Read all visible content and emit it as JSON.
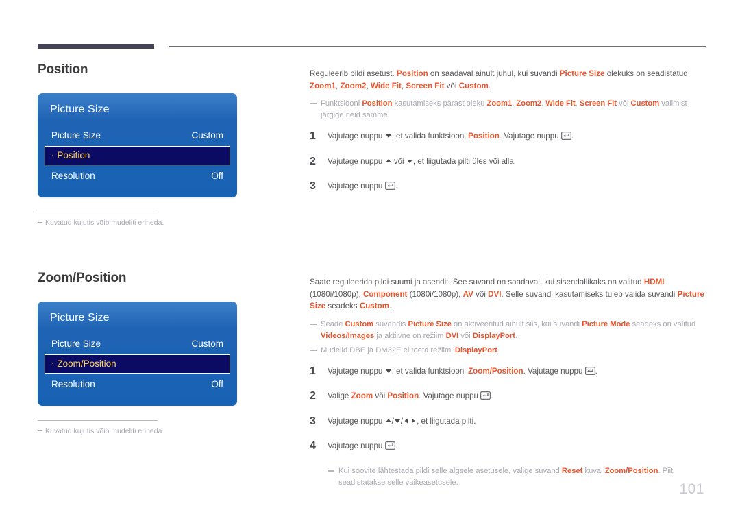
{
  "page": {
    "number": "101"
  },
  "sections": [
    {
      "id": "position",
      "heading": "Position",
      "osd": {
        "title": "Picture Size",
        "rows": [
          {
            "label": "Picture Size",
            "value": "Custom",
            "selected": false
          },
          {
            "label": "Position",
            "value": "",
            "selected": true
          },
          {
            "label": "Resolution",
            "value": "Off",
            "selected": false
          }
        ]
      },
      "osd_note": "Kuvatud kujutis võib mudeliti erineda."
    },
    {
      "id": "zoomposition",
      "heading": "Zoom/Position",
      "osd": {
        "title": "Picture Size",
        "rows": [
          {
            "label": "Picture Size",
            "value": "Custom",
            "selected": false
          },
          {
            "label": "Zoom/Position",
            "value": "",
            "selected": true
          },
          {
            "label": "Resolution",
            "value": "Off",
            "selected": false
          }
        ]
      },
      "osd_note": "Kuvatud kujutis võib mudeliti erineda."
    }
  ],
  "position_body": {
    "intro_1a": "Reguleerib pildi asetust. ",
    "intro_kw1": "Position",
    "intro_1b": " on saadaval ainult juhul, kui suvandi ",
    "intro_kw2": "Picture Size",
    "intro_1c": " olekuks on seadistatud ",
    "intro_kw3": "Zoom1",
    "intro_1d": ", ",
    "intro_kw4": "Zoom2",
    "intro_1e": ", ",
    "intro_kw5": "Wide Fit",
    "intro_1f": ", ",
    "intro_kw6": "Screen Fit",
    "intro_1g": " või ",
    "intro_kw7": "Custom",
    "intro_1h": ".",
    "note_a": "Funktsiooni ",
    "note_kw1": "Position",
    "note_b": " kasutamiseks pärast oleku ",
    "note_kw2": "Zoom1",
    "note_c": ", ",
    "note_kw3": "Zoom2",
    "note_d": ", ",
    "note_kw4": "Wide Fit",
    "note_e": ", ",
    "note_kw5": "Screen Fit",
    "note_f": " või ",
    "note_kw6": "Custom",
    "note_g": " valimist järgige neid samme.",
    "steps": [
      {
        "num": "1",
        "a": "Vajutage nuppu ",
        "icon1": "arrow-down-icon",
        "b": ", et valida funktsiooni ",
        "kw": "Position",
        "c": ". Vajutage nuppu ",
        "icon2": "enter-key-icon",
        "d": "."
      },
      {
        "num": "2",
        "a": "Vajutage nuppu ",
        "icon1": "arrow-up-icon",
        "b": " või ",
        "icon2": "arrow-down-icon",
        "c": ", et liigutada pilti üles või alla.",
        "kw": "",
        "d": ""
      },
      {
        "num": "3",
        "a": "Vajutage nuppu ",
        "icon1": "enter-key-icon",
        "b": ".",
        "kw": "",
        "c": "",
        "d": ""
      }
    ]
  },
  "zoomposition_body": {
    "intro_a": "Saate reguleerida pildi suumi ja asendit. See suvand on saadaval, kui sisendallikaks on valitud ",
    "intro_kw1": "HDMI",
    "intro_b": " (1080i/1080p), ",
    "intro_kw2": "Component",
    "intro_c": " (1080i/1080p), ",
    "intro_kw3": "AV",
    "intro_d": " või ",
    "intro_kw4": "DVI",
    "intro_e": ". Selle suvandi kasutamiseks tuleb valida suvandi ",
    "intro_kw5": "Picture Size",
    "intro_f": " seadeks ",
    "intro_kw6": "Custom",
    "intro_g": ".",
    "note1_a": "Seade ",
    "note1_kw1": "Custom",
    "note1_b": " suvandis ",
    "note1_kw2": "Picture Size",
    "note1_c": " on aktiveeritud ainult siis, kui suvandi ",
    "note1_kw3": "Picture Mode",
    "note1_d": " seadeks on valitud ",
    "note1_kw4": "Videos/Images",
    "note1_e": " ja aktiivne on režiim ",
    "note1_kw5": "DVI",
    "note1_f": " või ",
    "note1_kw6": "DisplayPort",
    "note1_g": ".",
    "note2_a": "Mudelid DBE ja DM32E ei toeta režiimi ",
    "note2_kw1": "DisplayPort",
    "note2_b": ".",
    "steps": [
      {
        "num": "1",
        "a": "Vajutage nuppu ",
        "icon1": "arrow-down-icon",
        "b": ", et valida funktsiooni ",
        "kw": "Zoom/Position",
        "c": ". Vajutage nuppu ",
        "icon2": "enter-key-icon",
        "d": "."
      },
      {
        "num": "2",
        "a": "Valige ",
        "kw": "Zoom",
        "b": " või ",
        "kw2": "Position",
        "c": ". Vajutage nuppu ",
        "icon2": "enter-key-icon",
        "d": "."
      },
      {
        "num": "3",
        "a": "Vajutage nuppu ",
        "icons": "arrow-up-down-left-right-icons",
        "b": ", et liigutada pilti.",
        "kw": "",
        "c": "",
        "d": ""
      },
      {
        "num": "4",
        "a": "Vajutage nuppu ",
        "icon1": "enter-key-icon",
        "b": ".",
        "kw": "",
        "c": "",
        "d": ""
      }
    ],
    "final_note_a": "Kui soovite lähtestada pildi selle algsele asetusele, valige suvand ",
    "final_note_kw1": "Reset",
    "final_note_b": " kuval ",
    "final_note_kw2": "Zoom/Position",
    "final_note_c": ". Piit seadistatakse selle vaikeasetusele."
  },
  "colors": {
    "accent": "#e8552d",
    "osd_blue_top": "#3c7fc8",
    "osd_blue_bottom": "#1862b4",
    "osd_selected_fill": "#0b0b63",
    "osd_selected_text": "#ffd24d",
    "rule_dark": "#454457",
    "note_gray": "#a9a9b0",
    "page_number": "#c8c8d2"
  }
}
